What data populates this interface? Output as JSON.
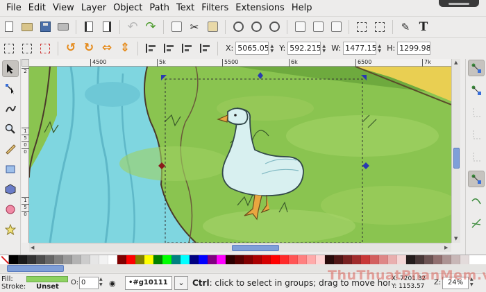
{
  "menubar": {
    "items": [
      "File",
      "Edit",
      "View",
      "Layer",
      "Object",
      "Path",
      "Text",
      "Filters",
      "Extensions",
      "Help"
    ],
    "underlines": [
      "F",
      "E",
      "V",
      "L",
      "O",
      "P",
      "T",
      "r",
      "x",
      "H"
    ]
  },
  "toolbar_commands": {
    "icons": [
      "new-document-icon",
      "open-folder-icon",
      "save-icon",
      "print-icon",
      "import-icon",
      "export-icon",
      "undo-icon",
      "redo-icon",
      "copy-icon",
      "cut-icon",
      "paste-icon",
      "zoom-selection-icon",
      "zoom-drawing-icon",
      "zoom-page-icon",
      "duplicate-icon",
      "clone-icon",
      "unlink-clone-icon",
      "group-icon",
      "ungroup-icon",
      "fill-stroke-icon",
      "text-font-icon"
    ]
  },
  "toolbar_select": {
    "x_label": "X:",
    "x_value": "5065.05",
    "y_label": "Y:",
    "y_value": "592.215",
    "w_label": "W:",
    "w_value": "1477.15",
    "h_label": "H:",
    "h_value": "1299.98"
  },
  "rulers": {
    "horizontal_ticks": [
      "4500",
      "5k",
      "5500",
      "6k",
      "6500",
      "7k"
    ],
    "vertical_ticks": [
      "2",
      "1",
      "5",
      "0",
      "0",
      "1",
      "5",
      "0"
    ]
  },
  "palette": {
    "colors": [
      "#000000",
      "#1a1a1a",
      "#333333",
      "#4d4d4d",
      "#666666",
      "#808080",
      "#999999",
      "#b3b3b3",
      "#cccccc",
      "#e6e6e6",
      "#f2f2f2",
      "#ffffff",
      "#800000",
      "#ff0000",
      "#808000",
      "#ffff00",
      "#008000",
      "#00ff00",
      "#008080",
      "#00ffff",
      "#000080",
      "#0000ff",
      "#800080",
      "#ff00ff",
      "#2b0000",
      "#550000",
      "#800000",
      "#aa0000",
      "#d40000",
      "#ff0000",
      "#ff2a2a",
      "#ff5555",
      "#ff8080",
      "#ffaaaa",
      "#ffd5d5",
      "#280b0b",
      "#501616",
      "#782121",
      "#a02c2c",
      "#c83737",
      "#d35f5f",
      "#de8787",
      "#e9afaf",
      "#f4d7d7",
      "#241c1c",
      "#483737",
      "#6c5353",
      "#916f6f",
      "#ac9393",
      "#c8b7b7",
      "#e3dbdb"
    ]
  },
  "statusbar": {
    "fill_label": "Fill:",
    "stroke_label": "Stroke:",
    "stroke_value": "Unset",
    "fill_color": "#8ed262",
    "opacity_label": "O:",
    "opacity_value": "0",
    "layer_value": "•#g10111",
    "message_bold": "Ctrl",
    "message_rest": ": click to select in groups; drag to move hor/ve",
    "cursor_x": "X: 7201.32",
    "cursor_y": "Y: 1153.57",
    "zoom_label": "Z:",
    "zoom_value": "24%"
  },
  "watermark": "ThuThuatPhanMem.vn"
}
